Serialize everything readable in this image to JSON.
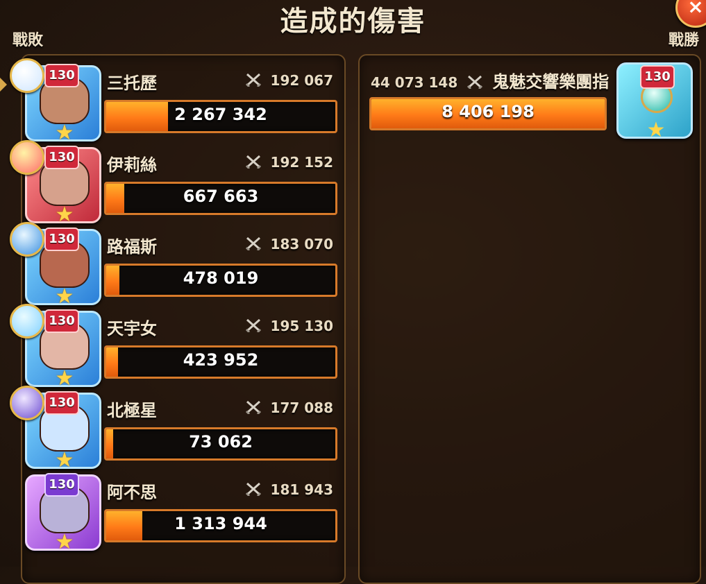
{
  "header": {
    "title": "造成的傷害",
    "left_label": "戰敗",
    "right_label": "戰勝",
    "close_glyph": "×"
  },
  "left_team": [
    {
      "name": "三托歷",
      "level": "130",
      "power": "192 067",
      "damage": "2 267 342",
      "damage_value": 2267342
    },
    {
      "name": "伊莉絲",
      "level": "130",
      "power": "192 152",
      "damage": "667 663",
      "damage_value": 667663
    },
    {
      "name": "路福斯",
      "level": "130",
      "power": "183 070",
      "damage": "478 019",
      "damage_value": 478019
    },
    {
      "name": "天宇女",
      "level": "130",
      "power": "195 130",
      "damage": "423 952",
      "damage_value": 423952
    },
    {
      "name": "北極星",
      "level": "130",
      "power": "177 088",
      "damage": "73 062",
      "damage_value": 73062
    },
    {
      "name": "阿不思",
      "level": "130",
      "power": "181 943",
      "damage": "1 313 944",
      "damage_value": 1313944
    }
  ],
  "right_team": {
    "power": "44 073 148",
    "name": "鬼魅交響樂團指",
    "level": "130",
    "damage": "8 406 198",
    "damage_value": 8406198
  },
  "bar_max_value": 8406198,
  "colors": {
    "bar_fill": "#ff7a18",
    "bar_border": "#d77a2a",
    "panel_border": "#6a4a25"
  }
}
